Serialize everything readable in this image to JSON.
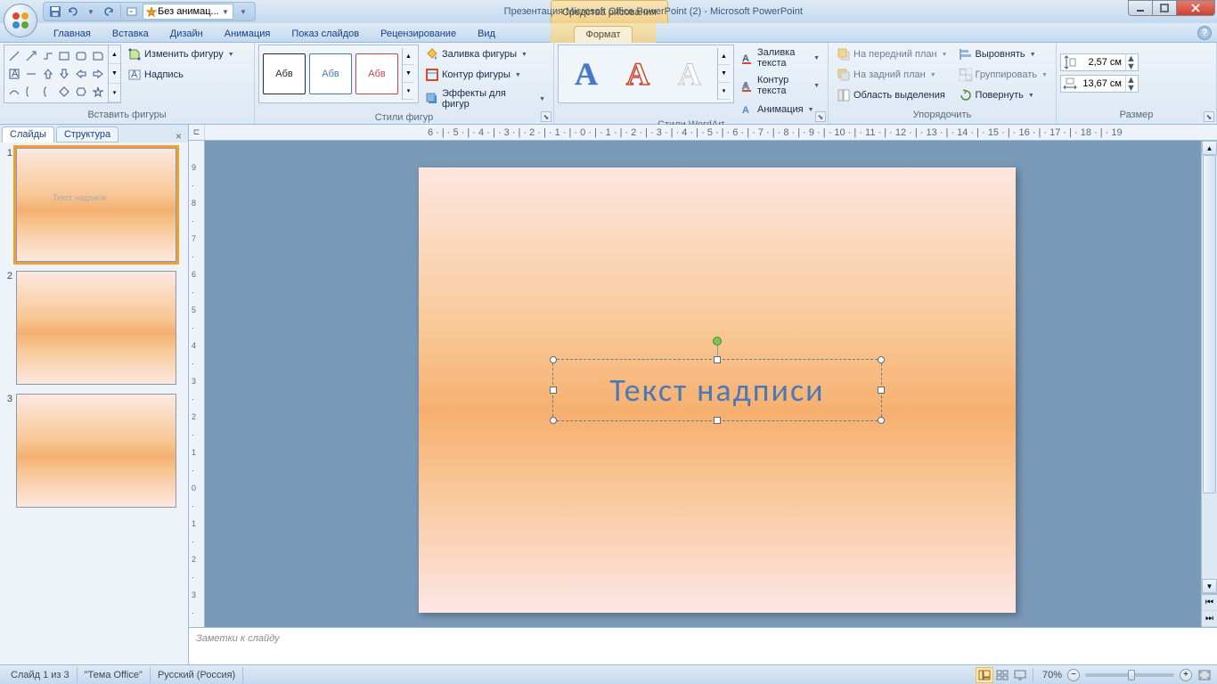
{
  "title": "Презентация Microsoft Office PowerPoint (2) - Microsoft PowerPoint",
  "context_tab": "Средства рисования",
  "qat_anim": "Без анимац...",
  "tabs": [
    "Главная",
    "Вставка",
    "Дизайн",
    "Анимация",
    "Показ слайдов",
    "Рецензирование",
    "Вид"
  ],
  "active_tab": "Формат",
  "ribbon": {
    "insert_shapes": {
      "edit_shape": "Изменить фигуру",
      "text_box": "Надпись",
      "label": "Вставить фигуры"
    },
    "shape_styles": {
      "sample": "Абв",
      "fill": "Заливка фигуры",
      "outline": "Контур фигуры",
      "effects": "Эффекты для фигур",
      "label": "Стили фигур"
    },
    "wordart": {
      "text_fill": "Заливка текста",
      "text_outline": "Контур текста",
      "animation": "Анимация",
      "label": "Стили WordArt"
    },
    "arrange": {
      "bring_front": "На передний план",
      "send_back": "На задний план",
      "selection_pane": "Область выделения",
      "align": "Выровнять",
      "group": "Группировать",
      "rotate": "Повернуть",
      "label": "Упорядочить"
    },
    "size": {
      "height": "2,57 см",
      "width": "13,67 см",
      "label": "Размер"
    }
  },
  "pane": {
    "tabs": [
      "Слайды",
      "Структура"
    ],
    "thumb_text": "Текст надписи"
  },
  "slide_text": "Текст надписи",
  "notes_placeholder": "Заметки к слайду",
  "status": {
    "slide": "Слайд 1 из 3",
    "theme": "\"Тема Office\"",
    "lang": "Русский (Россия)",
    "zoom": "70%"
  }
}
